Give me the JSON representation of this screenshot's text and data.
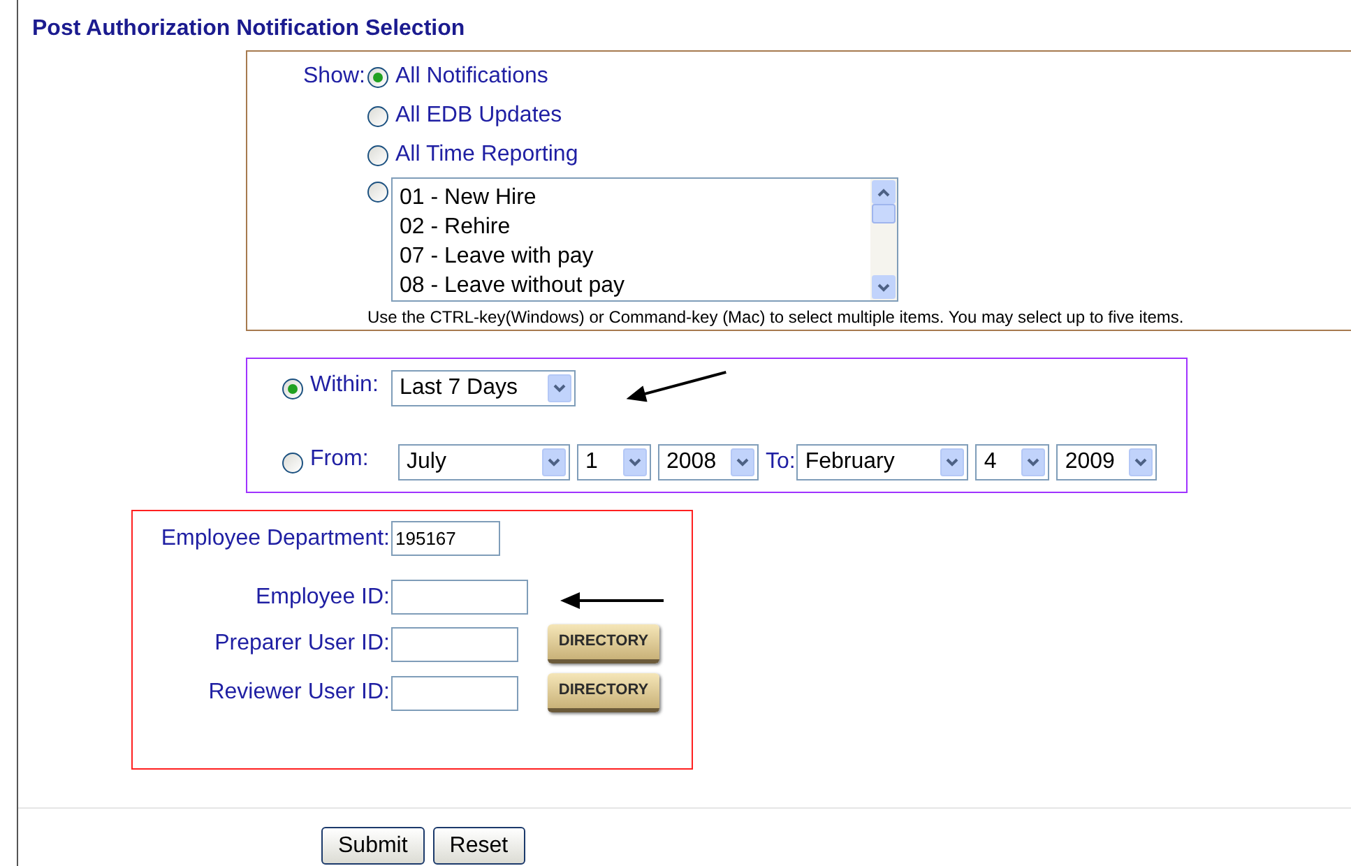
{
  "title": "Post Authorization Notification Selection",
  "show": {
    "label": "Show:",
    "options": [
      {
        "label": "All Notifications",
        "selected": true
      },
      {
        "label": "All EDB Updates",
        "selected": false
      },
      {
        "label": "All Time Reporting",
        "selected": false
      }
    ],
    "list_option": {
      "selected": false,
      "items": [
        "01 - New Hire",
        "02 - Rehire",
        "07 - Leave with pay",
        "08 - Leave without pay"
      ]
    },
    "hint": "Use the CTRL-key(Windows) or Command-key (Mac) to select multiple items. You may select up to five items."
  },
  "date_range": {
    "within": {
      "label": "Within:",
      "selected": true,
      "value": "Last 7 Days"
    },
    "from": {
      "label": "From:",
      "selected": false,
      "month": "July",
      "day": "1",
      "year": "2008"
    },
    "to_label": "To:",
    "to": {
      "month": "February",
      "day": "4",
      "year": "2009"
    }
  },
  "employee": {
    "fields": [
      {
        "label": "Employee Department:",
        "value": "195167"
      },
      {
        "label": "Employee ID:"
      },
      {
        "label": "Preparer User ID:",
        "directory_label": "DIRECTORY"
      },
      {
        "label": "Reviewer User ID:",
        "directory_label": "DIRECTORY"
      }
    ]
  },
  "buttons": [
    "Submit",
    "Reset"
  ]
}
